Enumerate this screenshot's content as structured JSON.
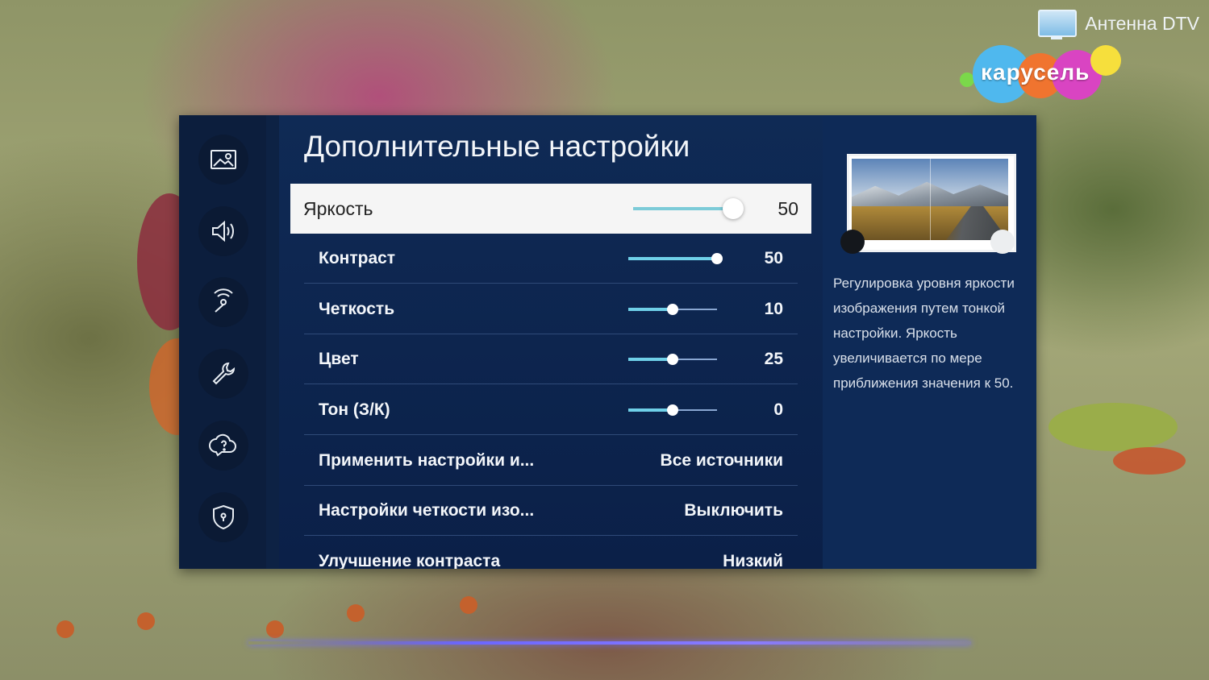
{
  "channel": {
    "name": "Антенна DTV",
    "logo_text": "карусель"
  },
  "menu": {
    "title": "Дополнительные настройки",
    "side_icons": [
      {
        "name": "picture-icon"
      },
      {
        "name": "sound-icon"
      },
      {
        "name": "broadcast-icon"
      },
      {
        "name": "wrench-icon"
      },
      {
        "name": "support-icon"
      },
      {
        "name": "shield-icon"
      }
    ],
    "selected": {
      "label": "Яркость",
      "value": "50",
      "slider_fraction": 1.0
    },
    "rows": [
      {
        "label": "Контраст",
        "value": "50",
        "type": "slider",
        "slider_fraction": 1.0
      },
      {
        "label": "Четкость",
        "value": "10",
        "type": "slider",
        "slider_fraction": 0.5
      },
      {
        "label": "Цвет",
        "value": "25",
        "type": "slider",
        "slider_fraction": 0.5
      },
      {
        "label": "Тон (З/К)",
        "value": "0",
        "type": "slider",
        "slider_fraction": 0.5
      },
      {
        "label": "Применить настройки и...",
        "value": "Все источники",
        "type": "option"
      },
      {
        "label": "Настройки четкости изо...",
        "value": "Выключить",
        "type": "option"
      },
      {
        "label": "Улучшение контраста",
        "value": "Низкий",
        "type": "option"
      }
    ]
  },
  "info": {
    "description": "Регулировка уровня яркости изображения путем тонкой настройки. Яркость увеличивается по мере приближения значения к 50."
  },
  "colors": {
    "panel": "#0f2a55",
    "slider_fill": "#6fd0e8",
    "selected_row": "#f5f5f5"
  }
}
